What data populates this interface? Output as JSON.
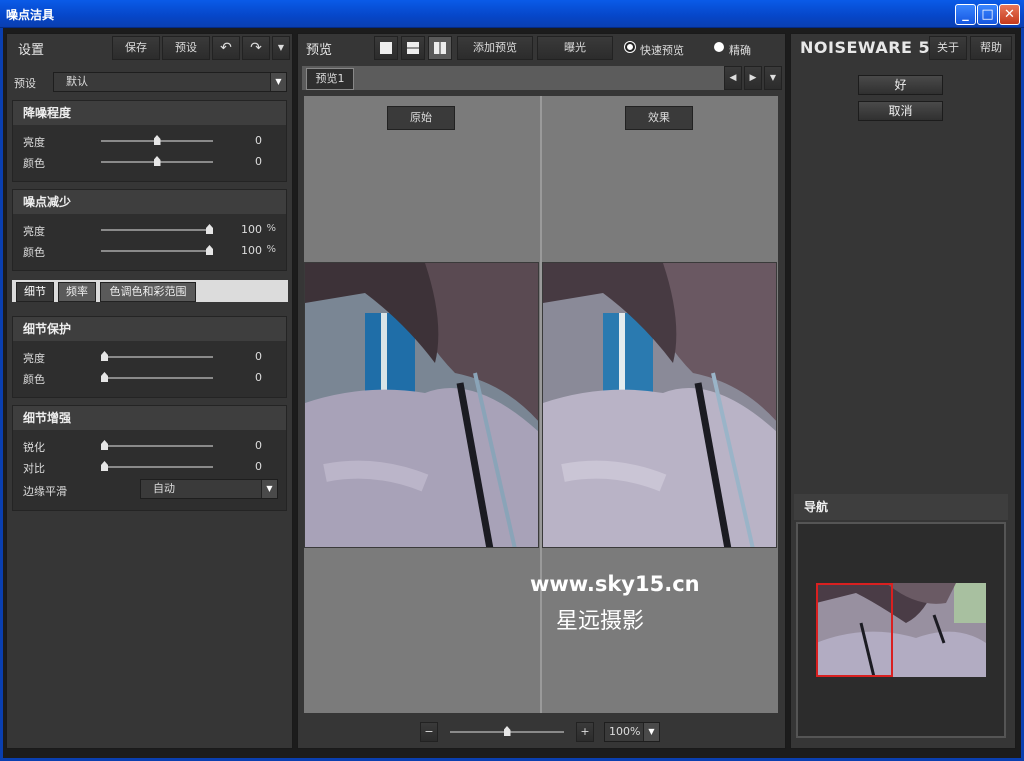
{
  "window": {
    "title": "噪点洁具",
    "min": "_",
    "max": "□",
    "close": "✕"
  },
  "left": {
    "title": "设置",
    "save": "保存",
    "presets_btn": "预设",
    "undo": "↶",
    "redo": "↷",
    "menu": "▼",
    "preset_label": "预设",
    "preset_value": "默认",
    "noise_level": {
      "title": "降噪程度",
      "rows": [
        {
          "label": "亮度",
          "value": "0",
          "level": 0.5
        },
        {
          "label": "颜色",
          "value": "0",
          "level": 0.5
        }
      ]
    },
    "noise_reduction": {
      "title": "噪点减少",
      "rows": [
        {
          "label": "亮度",
          "value": "100",
          "unit": "%",
          "level": 1
        },
        {
          "label": "颜色",
          "value": "100",
          "unit": "%",
          "level": 1
        }
      ]
    },
    "tabs": [
      "细节",
      "频率",
      "色调色和彩范围"
    ],
    "detail_protect": {
      "title": "细节保护",
      "rows": [
        {
          "label": "亮度",
          "value": "0",
          "level": 0
        },
        {
          "label": "颜色",
          "value": "0",
          "level": 0
        }
      ]
    },
    "detail_enhance": {
      "title": "细节增强",
      "rows": [
        {
          "label": "锐化",
          "value": "0",
          "level": 0
        },
        {
          "label": "对比",
          "value": "0",
          "level": 0
        }
      ],
      "edge_label": "边缘平滑",
      "edge_value": "自动"
    }
  },
  "center": {
    "title": "预览",
    "add_preview": "添加预览",
    "exposure": "曝光",
    "fast_preview": "快速预览",
    "accurate": "精确",
    "tab": "预览1",
    "original": "原始",
    "effect": "效果",
    "zoom_minus": "−",
    "zoom_plus": "+",
    "zoom_value": "100%",
    "zoom_level": 0.5
  },
  "right": {
    "brand": "NOISEWARE 5",
    "about": "关于",
    "help": "帮助",
    "ok": "好",
    "cancel": "取消",
    "navigator": "导航"
  },
  "watermark": {
    "url": "www.sky15.cn",
    "text": "星远摄影"
  }
}
